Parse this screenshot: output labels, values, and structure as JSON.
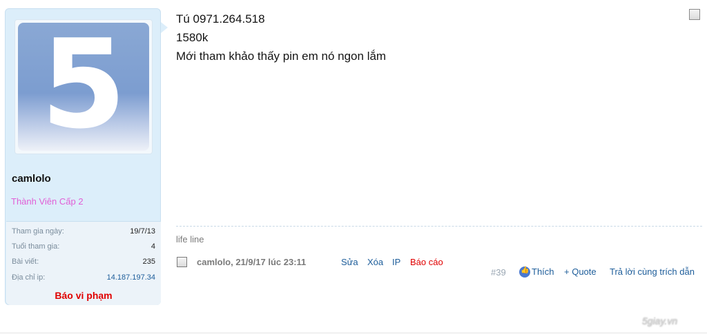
{
  "user": {
    "avatar_digit": "5",
    "username": "camlolo",
    "title": "Thành Viên Cấp 2",
    "stats": [
      {
        "label": "Tham gia ngày:",
        "value": "19/7/13"
      },
      {
        "label": "Tuổi tham gia:",
        "value": "4"
      },
      {
        "label": "Bài viết:",
        "value": "235"
      },
      {
        "label": "Địa chỉ ip:",
        "value": "14.187.197.34"
      }
    ],
    "report_label": "Báo vi phạm"
  },
  "message": {
    "lines": [
      "Tú 0971.264.518",
      "1580k",
      "Mới tham khảo thấy pin em nó ngon lắm"
    ]
  },
  "signature": "life line",
  "meta": {
    "author_date": "camlolo, 21/9/17 lúc 23:11",
    "edit_label": "Sửa",
    "delete_label": "Xóa",
    "ip_label": "IP",
    "report_label": "Báo cáo"
  },
  "actions": {
    "post_number": "#39",
    "like_label": "Thích",
    "quote_label": "+ Quote",
    "reply_label": "Trả lời cùng trích dẫn"
  },
  "watermark": "5giay.vn",
  "colors": {
    "panel_bg": "#dceefa",
    "link": "#1d5d9a",
    "danger": "#e00000",
    "user_title": "#e15fd6"
  }
}
